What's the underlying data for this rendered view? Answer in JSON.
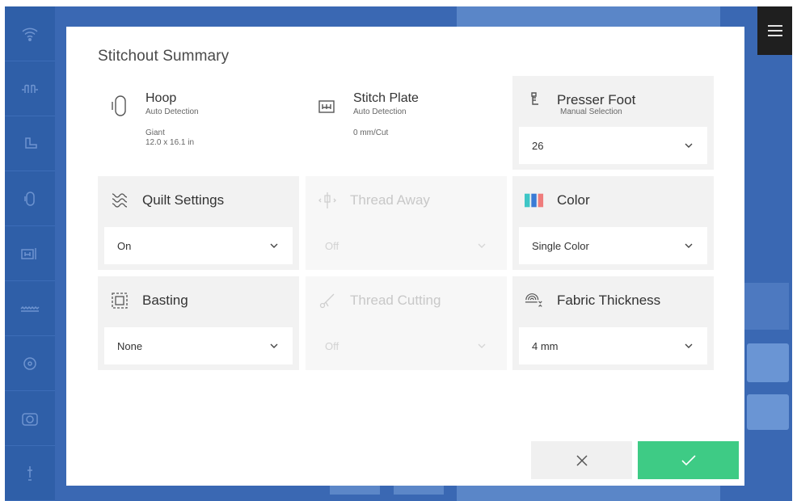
{
  "background": {
    "rail_icons": [
      "wifi-icon",
      "stitch-icon",
      "presser-foot-icon",
      "hoop-icon",
      "stitch-plate-icon",
      "zigzag-icon",
      "location-icon",
      "camera-icon",
      "needle-icon"
    ],
    "menu_icon": "hamburger-menu-icon",
    "colors": {
      "app": "#3a68b3",
      "rail": "#2f5fa8",
      "accent_ok": "#3ecb85"
    }
  },
  "dialog": {
    "title": "Stitchout Summary",
    "hoop": {
      "label": "Hoop",
      "sub": "Auto Detection",
      "value_line1": "Giant",
      "value_line2": "12.0 x 16.1 in"
    },
    "stitch_plate": {
      "label": "Stitch Plate",
      "sub": "Auto Detection",
      "value": "0 mm/Cut"
    },
    "presser_foot": {
      "label": "Presser Foot",
      "sub": "Manual Selection",
      "value": "26"
    },
    "quilt_settings": {
      "label": "Quilt Settings",
      "value": "On"
    },
    "thread_away": {
      "label": "Thread Away",
      "value": "Off"
    },
    "color": {
      "label": "Color",
      "value": "Single Color"
    },
    "basting": {
      "label": "Basting",
      "value": "None"
    },
    "thread_cutting": {
      "label": "Thread Cutting",
      "value": "Off"
    },
    "fabric_thickness": {
      "label": "Fabric Thickness",
      "value": "4 mm"
    },
    "buttons": {
      "cancel_icon": "close-icon",
      "confirm_icon": "check-icon"
    }
  }
}
